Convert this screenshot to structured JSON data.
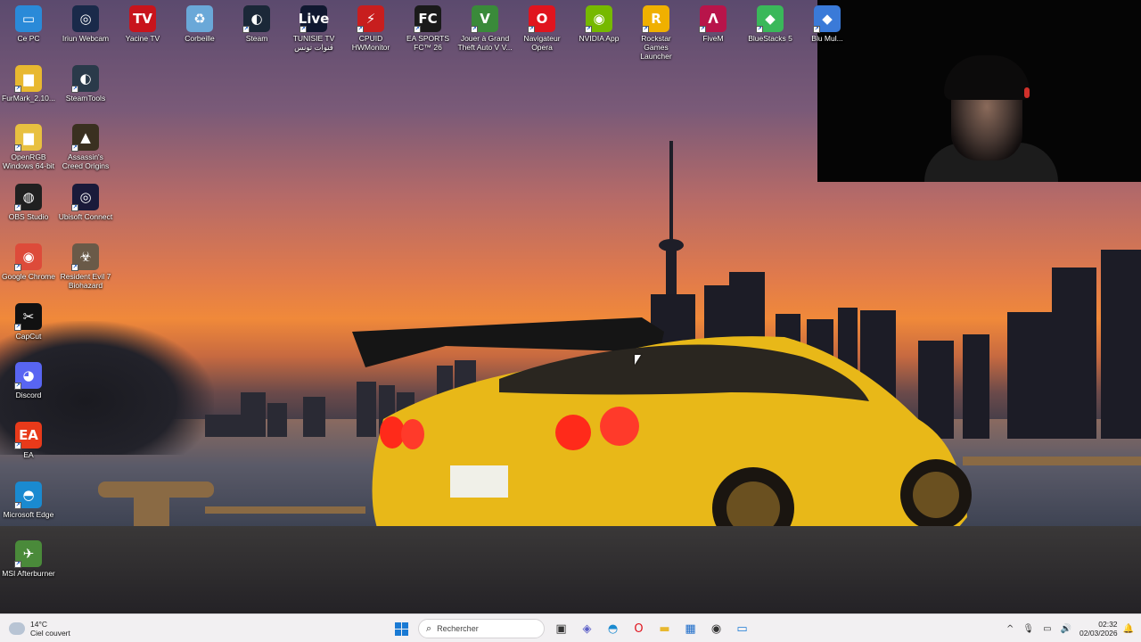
{
  "desktop": {
    "icons": [
      {
        "name": "ce-pc",
        "label": "Ce PC",
        "glyph": "▭",
        "color": "#2a8ad8"
      },
      {
        "name": "iriun-webcam",
        "label": "Iriun Webcam",
        "glyph": "◎",
        "color": "#1a2a4a"
      },
      {
        "name": "yacine-tv",
        "label": "Yacine TV",
        "glyph": "TV",
        "color": "#c8141c"
      },
      {
        "name": "corbeille",
        "label": "Corbeille",
        "glyph": "♻",
        "color": "#6aa8d8"
      },
      {
        "name": "steam",
        "label": "Steam",
        "glyph": "◐",
        "color": "#1b2838"
      },
      {
        "name": "tunisie-tv",
        "label": "TUNISIE TV قنوات تونس",
        "glyph": "Live",
        "color": "#101830"
      },
      {
        "name": "cpuid-hwmonitor",
        "label": "CPUID HWMonitor",
        "glyph": "⚡",
        "color": "#c81e1e"
      },
      {
        "name": "ea-sports-fc",
        "label": "EA SPORTS FC™ 26",
        "glyph": "FC",
        "color": "#1a1a1a"
      },
      {
        "name": "gta-v",
        "label": "Jouer à Grand Theft Auto V V...",
        "glyph": "V",
        "color": "#3a8a3a"
      },
      {
        "name": "opera",
        "label": "Navigateur Opera",
        "glyph": "O",
        "color": "#e0141e"
      },
      {
        "name": "nvidia-app",
        "label": "NVIDIA App",
        "glyph": "◉",
        "color": "#76b900"
      },
      {
        "name": "rockstar-launcher",
        "label": "Rockstar Games Launcher",
        "glyph": "R",
        "color": "#f0b000"
      },
      {
        "name": "fivem",
        "label": "FiveM",
        "glyph": "Λ",
        "color": "#b8144a"
      },
      {
        "name": "bluestacks",
        "label": "BlueStacks 5",
        "glyph": "◆",
        "color": "#3ab85a"
      },
      {
        "name": "bluestacks-multi",
        "label": "Blu Mul...",
        "glyph": "◆",
        "color": "#3a7ad8"
      },
      {
        "name": "furmark",
        "label": "FurMark_2.10...",
        "glyph": "▆",
        "color": "#e8b830"
      },
      {
        "name": "steamtools",
        "label": "SteamTools",
        "glyph": "◐",
        "color": "#2a3a4a"
      },
      {
        "name": "openrgb",
        "label": "OpenRGB Windows 64-bit",
        "glyph": "▆",
        "color": "#e8c040"
      },
      {
        "name": "assassins-creed-origins",
        "label": "Assassin's Creed Origins",
        "glyph": "▲",
        "color": "#3a3020"
      },
      {
        "name": "obs-studio",
        "label": "OBS Studio",
        "glyph": "◍",
        "color": "#202020"
      },
      {
        "name": "ubisoft-connect",
        "label": "Ubisoft Connect",
        "glyph": "◎",
        "color": "#1a1a3a"
      },
      {
        "name": "google-chrome",
        "label": "Google Chrome",
        "glyph": "◉",
        "color": "#dd4b3a"
      },
      {
        "name": "resident-evil-7",
        "label": "Resident Evil 7 Biohazard",
        "glyph": "☣",
        "color": "#6a5a48"
      },
      {
        "name": "capcut",
        "label": "CapCut",
        "glyph": "✂",
        "color": "#111111"
      },
      {
        "name": "discord",
        "label": "Discord",
        "glyph": "◕",
        "color": "#5865f2"
      },
      {
        "name": "ea",
        "label": "EA",
        "glyph": "EA",
        "color": "#e83a1a"
      },
      {
        "name": "microsoft-edge",
        "label": "Microsoft Edge",
        "glyph": "◓",
        "color": "#1a8ad0"
      },
      {
        "name": "msi-afterburner",
        "label": "MSI Afterburner",
        "glyph": "✈",
        "color": "#4a8a3a"
      }
    ]
  },
  "taskbar": {
    "weather_temp": "14°C",
    "weather_desc": "Ciel couvert",
    "search_placeholder": "Rechercher",
    "search_glyph": "⌕",
    "apps": [
      {
        "name": "task-view",
        "glyph": "▣",
        "color": "#333333"
      },
      {
        "name": "teams",
        "glyph": "◈",
        "color": "#5b5fc7"
      },
      {
        "name": "edge",
        "glyph": "◓",
        "color": "#1a8ad0"
      },
      {
        "name": "opera",
        "glyph": "O",
        "color": "#e0141e"
      },
      {
        "name": "file-explorer",
        "glyph": "▬",
        "color": "#e8b830"
      },
      {
        "name": "microsoft-store",
        "glyph": "▦",
        "color": "#1a6ac8"
      },
      {
        "name": "chrome-recording",
        "glyph": "◉",
        "color": "#333333"
      },
      {
        "name": "active-window",
        "glyph": "▭",
        "color": "#1a7ad4"
      }
    ],
    "tray": {
      "chevron": "^",
      "mic": "🎙",
      "network": "▭",
      "volume": "🔊",
      "time": "02:32",
      "date": "02/03/2026",
      "notification": "🔔"
    }
  }
}
